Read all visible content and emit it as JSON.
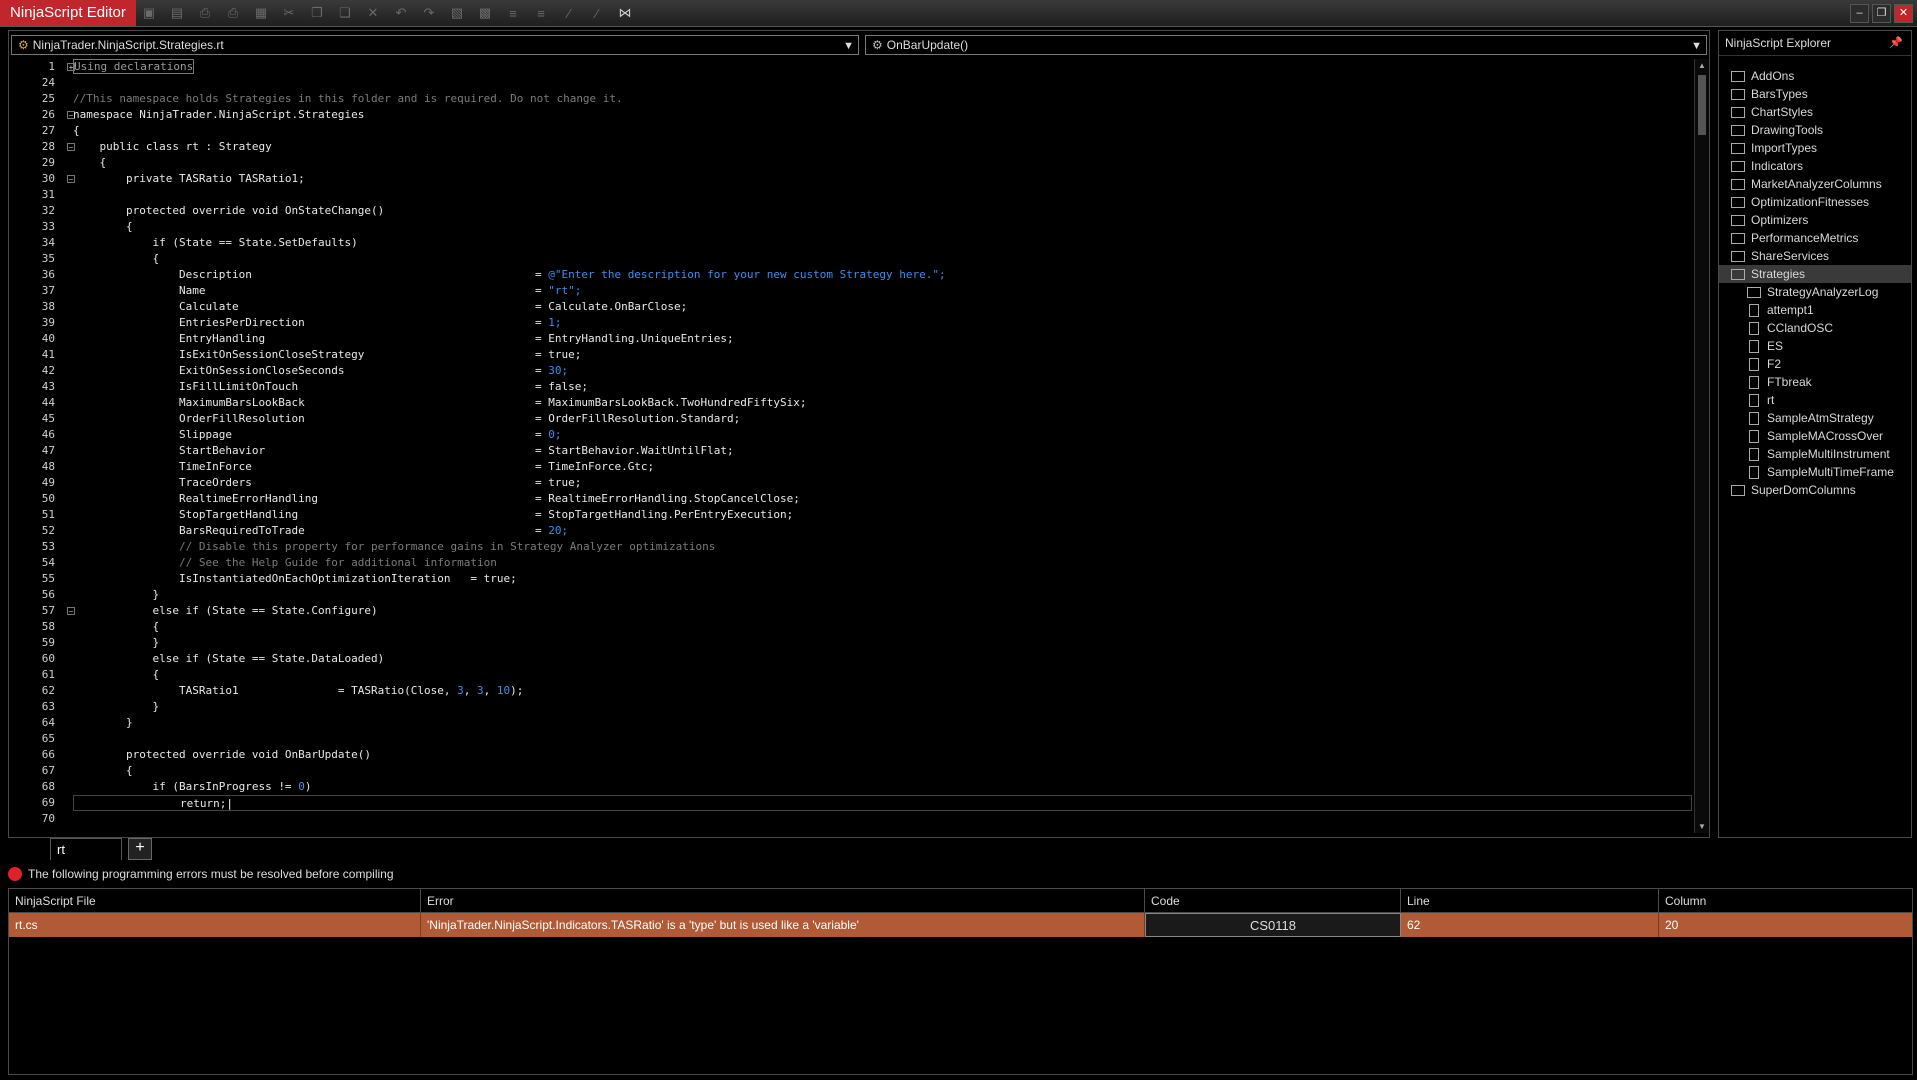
{
  "window": {
    "title": "NinjaScript Editor"
  },
  "toolbar": {
    "icons": [
      "save-icon",
      "save-all-icon",
      "print-icon",
      "print-preview-icon",
      "compile-icon",
      "cut-icon",
      "copy-icon",
      "paste-icon",
      "delete-icon",
      "undo-icon",
      "redo-icon",
      "find-icon",
      "insert-code-icon",
      "indent-icon",
      "outdent-icon",
      "comment-icon",
      "uncomment-icon",
      "visual-studio-icon"
    ]
  },
  "editor": {
    "file_combo": "NinjaTrader.NinjaScript.Strategies.rt",
    "method_combo": "OnBarUpdate()",
    "line_numbers": [
      "1",
      "24",
      "25",
      "26",
      "27",
      "28",
      "29",
      "30",
      "31",
      "32",
      "33",
      "34",
      "35",
      "36",
      "37",
      "38",
      "39",
      "40",
      "41",
      "42",
      "43",
      "44",
      "45",
      "46",
      "47",
      "48",
      "49",
      "50",
      "51",
      "52",
      "53",
      "54",
      "55",
      "56",
      "57",
      "58",
      "59",
      "60",
      "61",
      "62",
      "63",
      "64",
      "65",
      "66",
      "67",
      "68",
      "69",
      "70"
    ],
    "region_label": "Using declarations",
    "comment_line": "//This namespace holds Strategies in this folder and is required. Do not change it.",
    "namespace_line": "namespace NinjaTrader.NinjaScript.Strategies",
    "brace_open": "{",
    "brace_close": "}",
    "class_line": "public class rt : Strategy",
    "field_line": "private TASRatio TASRatio1;",
    "onstate_line": "protected override void OnStateChange()",
    "if_defaults": "if (State == State.SetDefaults)",
    "props": [
      {
        "name": "Description",
        "value": "@\"Enter the description for your new custom Strategy here.\";",
        "vtype": "str"
      },
      {
        "name": "Name",
        "value": "\"rt\";",
        "vtype": "str"
      },
      {
        "name": "Calculate",
        "value": "Calculate.OnBarClose;",
        "vtype": "id"
      },
      {
        "name": "EntriesPerDirection",
        "value": "1;",
        "vtype": "num"
      },
      {
        "name": "EntryHandling",
        "value": "EntryHandling.UniqueEntries;",
        "vtype": "id"
      },
      {
        "name": "IsExitOnSessionCloseStrategy",
        "value": "true;",
        "vtype": "id"
      },
      {
        "name": "ExitOnSessionCloseSeconds",
        "value": "30;",
        "vtype": "num"
      },
      {
        "name": "IsFillLimitOnTouch",
        "value": "false;",
        "vtype": "id"
      },
      {
        "name": "MaximumBarsLookBack",
        "value": "MaximumBarsLookBack.TwoHundredFiftySix;",
        "vtype": "id"
      },
      {
        "name": "OrderFillResolution",
        "value": "OrderFillResolution.Standard;",
        "vtype": "id"
      },
      {
        "name": "Slippage",
        "value": "0;",
        "vtype": "num"
      },
      {
        "name": "StartBehavior",
        "value": "StartBehavior.WaitUntilFlat;",
        "vtype": "id"
      },
      {
        "name": "TimeInForce",
        "value": "TimeInForce.Gtc;",
        "vtype": "id"
      },
      {
        "name": "TraceOrders",
        "value": "true;",
        "vtype": "id"
      },
      {
        "name": "RealtimeErrorHandling",
        "value": "RealtimeErrorHandling.StopCancelClose;",
        "vtype": "id"
      },
      {
        "name": "StopTargetHandling",
        "value": "StopTargetHandling.PerEntryExecution;",
        "vtype": "id"
      },
      {
        "name": "BarsRequiredToTrade",
        "value": "20;",
        "vtype": "num"
      }
    ],
    "comment_disable": "// Disable this property for performance gains in Strategy Analyzer optimizations",
    "comment_help": "// See the Help Guide for additional information",
    "instantiated_line": "IsInstantiatedOnEachOptimizationIteration   = true;",
    "else_configure": "else if (State == State.Configure)",
    "else_dataloaded": "else if (State == State.DataLoaded)",
    "tas_line": {
      "left": "TASRatio1               = TASRatio(Close, ",
      "a": "3",
      "sep1": ", ",
      "b": "3",
      "sep2": ", ",
      "c": "10",
      "end": ");"
    },
    "onbar_line": "protected override void OnBarUpdate()",
    "if_bars": {
      "left": "if (BarsInProgress != ",
      "num": "0",
      "end": ")"
    },
    "return_line": "return;"
  },
  "tabs": {
    "active": "rt",
    "add_label": "+"
  },
  "explorer": {
    "title": "NinjaScript Explorer",
    "pin_icon": "pin-icon",
    "folders_top": [
      "AddOns",
      "BarsTypes",
      "ChartStyles",
      "DrawingTools",
      "ImportTypes",
      "Indicators",
      "MarketAnalyzerColumns",
      "OptimizationFitnesses",
      "Optimizers",
      "PerformanceMetrics",
      "ShareServices"
    ],
    "selected_folder": "Strategies",
    "subfolder": "StrategyAnalyzerLog",
    "files": [
      "attempt1",
      "CClandOSC",
      "ES",
      "F2",
      "FTbreak",
      "rt",
      "SampleAtmStrategy",
      "SampleMACrossOver",
      "SampleMultiInstrument",
      "SampleMultiTimeFrame"
    ],
    "folders_bottom": [
      "SuperDomColumns"
    ]
  },
  "errors": {
    "message": "The following programming errors must be resolved before compiling",
    "columns": [
      "NinjaScript File",
      "Error",
      "Code",
      "Line",
      "Column"
    ],
    "rows": [
      {
        "file": "rt.cs",
        "error": "'NinjaTrader.NinjaScript.Indicators.TASRatio' is a 'type' but is used like a 'variable'",
        "code": "CS0118",
        "line": "62",
        "column": "20"
      }
    ]
  },
  "colors": {
    "accent": "#c0262b",
    "error_row": "#b05a36",
    "code_number": "#3c8ef0",
    "comment": "#7a7a7a"
  }
}
